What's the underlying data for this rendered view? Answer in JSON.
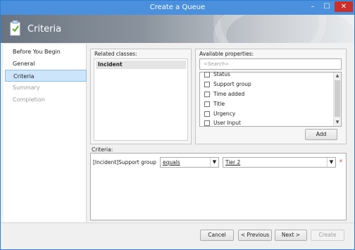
{
  "window": {
    "title": "Create a Queue",
    "min": "–",
    "max": "☐",
    "close": "✕"
  },
  "banner": {
    "title": "Criteria"
  },
  "nav": {
    "items": [
      {
        "label": "Before You Begin",
        "state": "normal"
      },
      {
        "label": "General",
        "state": "normal"
      },
      {
        "label": "Criteria",
        "state": "active"
      },
      {
        "label": "Summary",
        "state": "dim"
      },
      {
        "label": "Completion",
        "state": "dim"
      }
    ]
  },
  "related": {
    "label": "Related classes:",
    "items": [
      "Incident"
    ]
  },
  "available": {
    "label": "Available properties:",
    "search_placeholder": "<Search>",
    "properties": [
      "Status",
      "Support group",
      "Time added",
      "Title",
      "Urgency",
      "User Input"
    ],
    "add_label": "Add"
  },
  "criteria": {
    "label": "Criteria:",
    "field": "[Incident]Support group",
    "operator": "equals",
    "value": "Tier 2",
    "remove_icon": "✕"
  },
  "footer": {
    "cancel": "Cancel",
    "previous": "< Previous",
    "next": "Next >",
    "create": "Create"
  },
  "colors": {
    "accent": "#4a90dd",
    "nav_active": "#cde5fb",
    "close": "#c9302c"
  }
}
